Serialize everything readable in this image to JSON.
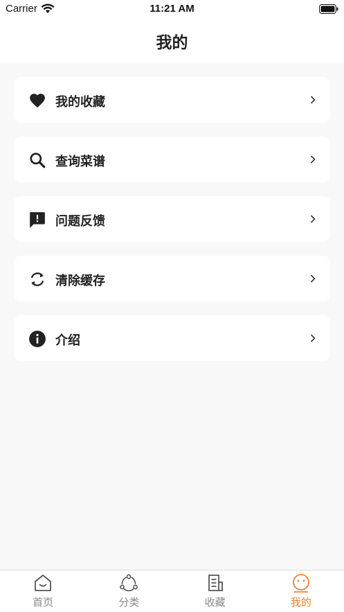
{
  "status_bar": {
    "carrier": "Carrier",
    "time": "11:21 AM"
  },
  "nav": {
    "title": "我的"
  },
  "menu": [
    {
      "label": "我的收藏",
      "icon": "heart-icon"
    },
    {
      "label": "查询菜谱",
      "icon": "search-icon"
    },
    {
      "label": "问题反馈",
      "icon": "feedback-icon"
    },
    {
      "label": "清除缓存",
      "icon": "refresh-icon"
    },
    {
      "label": "介绍",
      "icon": "info-icon"
    }
  ],
  "tabs": [
    {
      "label": "首页",
      "icon": "home-icon",
      "active": false
    },
    {
      "label": "分类",
      "icon": "category-icon",
      "active": false
    },
    {
      "label": "收藏",
      "icon": "collection-icon",
      "active": false
    },
    {
      "label": "我的",
      "icon": "smiley-icon",
      "active": true
    }
  ],
  "colors": {
    "accent": "#f0822e",
    "inactive": "#888888",
    "background": "#f8f8f8"
  }
}
